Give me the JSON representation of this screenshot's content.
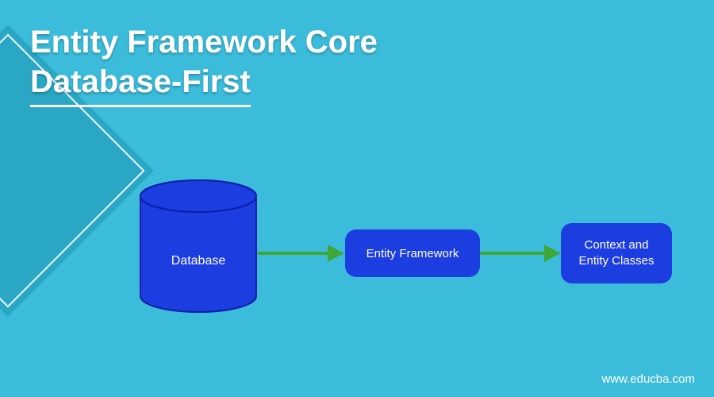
{
  "title": {
    "line1": "Entity Framework Core",
    "line2": "Database-First"
  },
  "diagram": {
    "nodes": {
      "database": "Database",
      "framework": "Entity Framework",
      "classes": "Context and\nEntity Classes"
    }
  },
  "footer": {
    "url": "www.educba.com"
  },
  "colors": {
    "background": "#3bbcdb",
    "node_fill": "#1c3de0",
    "arrow": "#3ea737",
    "text": "#ffffff"
  }
}
